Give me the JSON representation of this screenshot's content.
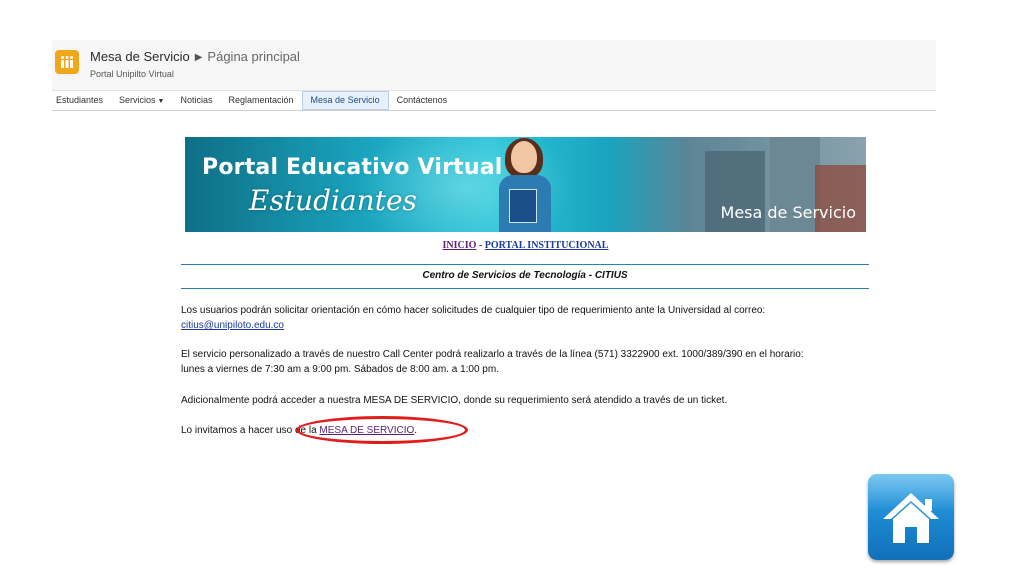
{
  "header": {
    "site_title": "Mesa de Servicio",
    "page_title": "Página principal",
    "subtitle": "Portal Unipilto Virtual"
  },
  "nav": {
    "items": [
      {
        "label": "Estudiantes"
      },
      {
        "label": "Servicios"
      },
      {
        "label": "Noticias"
      },
      {
        "label": "Reglamentación"
      },
      {
        "label": "Mesa de Servicio",
        "active": true
      },
      {
        "label": "Contáctenos"
      }
    ]
  },
  "banner": {
    "title_line1": "Portal Educativo Virtual",
    "title_line2": "Estudiantes",
    "tag": "Mesa de Servicio"
  },
  "links": {
    "inicio": "INICIO",
    "separator": "-",
    "portal": "PORTAL INSTITUCIONAL"
  },
  "section_title": "Centro de  Servicios de Tecnología - CITIUS",
  "paragraphs": {
    "p1_text": "Los usuarios podrán solicitar orientación en cómo hacer solicitudes de cualquier tipo de requerimiento ante la Universidad al correo:",
    "p1_email": "citius@unipiloto.edu.co",
    "p2_line1": "El servicio personalizado a través de nuestro Call Center podrá realizarlo a través de la línea (571) 3322900 ext. 1000/389/390  en el horario:",
    "p2_line2": "lunes a viernes de 7:30 am a 9:00 pm. Sábados de 8:00 am. a 1:00 pm.",
    "p3": "Adicionalmente podrá acceder a nuestra MESA DE SERVICIO, donde su requerimiento será atendido a través de un ticket.",
    "p4_prefix": "Lo invitamos a hacer uso de la ",
    "p4_link": "MESA DE SERVICIO",
    "p4_suffix": "."
  },
  "colors": {
    "accent_blue": "#2b7fb4",
    "highlight_red": "#e01d1d",
    "logo_orange": "#f2a71b"
  },
  "icons": {
    "logo": "site-logo-icon",
    "home": "home-icon"
  }
}
